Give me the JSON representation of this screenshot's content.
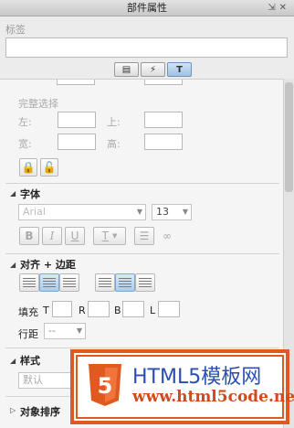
{
  "window": {
    "title": "部件属性",
    "pin_icon": "pin-icon",
    "close_icon": "close-icon"
  },
  "label_section": {
    "title": "标签",
    "value": ""
  },
  "tabs": [
    {
      "icon": "list-icon",
      "glyph": "▤",
      "active": false
    },
    {
      "icon": "lightning-icon",
      "glyph": "⚡",
      "active": false
    },
    {
      "icon": "style-icon",
      "glyph": "T",
      "active": true
    }
  ],
  "position": {
    "x_value": "",
    "y_value": ""
  },
  "complete_selection": {
    "title": "完整选择",
    "left_label": "左:",
    "top_label": "上:",
    "width_label": "宽:",
    "height_label": "高:",
    "left_value": "",
    "top_value": "",
    "width_value": "",
    "height_value": ""
  },
  "font": {
    "title": "字体",
    "family": "Arial",
    "size": "13",
    "bold": "B",
    "italic": "I",
    "underline": "U",
    "text_color": "T"
  },
  "align": {
    "title": "对齐 + 边距",
    "padding_label": "填充",
    "t_label": "T",
    "r_label": "R",
    "b_label": "B",
    "l_label": "L",
    "line_spacing_label": "行距",
    "line_spacing_value": "--"
  },
  "style": {
    "title": "样式",
    "value": "默认"
  },
  "order": {
    "title": "对象排序"
  },
  "watermark": {
    "title": "HTML5模板网",
    "url": "www.html5code.net",
    "logo_text": "5"
  },
  "colors": {
    "accent": "#e05a1f",
    "brand": "#2a4fae",
    "active_tab": "#9fc2e6"
  }
}
